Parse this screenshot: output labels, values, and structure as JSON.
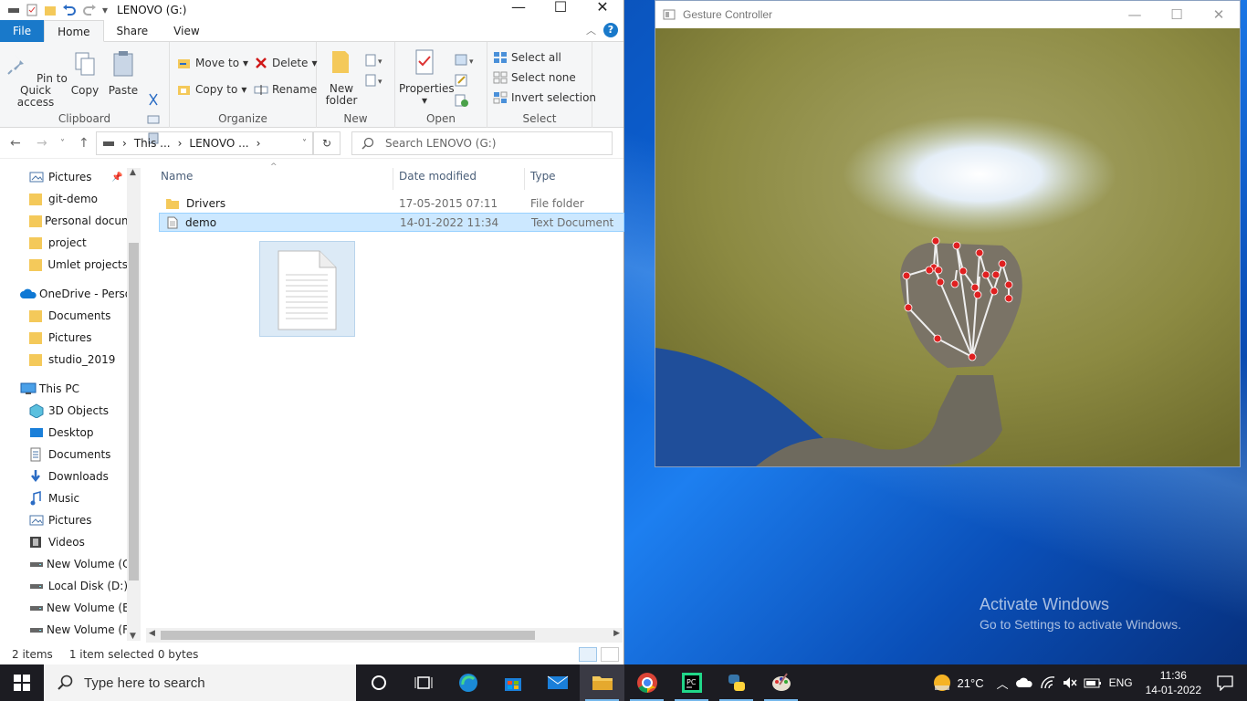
{
  "explorer": {
    "title": "LENOVO (G:)",
    "tabs": {
      "file": "File",
      "home": "Home",
      "share": "Share",
      "view": "View"
    },
    "ribbon": {
      "clipboard": {
        "label": "Clipboard",
        "pin": "Pin to Quick access",
        "copy": "Copy",
        "paste": "Paste"
      },
      "organize": {
        "label": "Organize",
        "move_to": "Move to",
        "copy_to": "Copy to",
        "delete": "Delete",
        "rename": "Rename"
      },
      "new": {
        "label": "New",
        "new_folder": "New folder"
      },
      "open": {
        "label": "Open",
        "properties": "Properties"
      },
      "select": {
        "label": "Select",
        "select_all": "Select all",
        "select_none": "Select none",
        "invert": "Invert selection"
      }
    },
    "address": {
      "part1": "This ...",
      "part2": "LENOVO ..."
    },
    "search": {
      "placeholder": "Search LENOVO (G:)"
    },
    "nav": [
      {
        "label": "Pictures",
        "icon": "pictures-icon"
      },
      {
        "label": "git-demo",
        "icon": "folder-icon"
      },
      {
        "label": "Personal docum",
        "icon": "folder-icon"
      },
      {
        "label": "project",
        "icon": "folder-icon"
      },
      {
        "label": "Umlet projects",
        "icon": "folder-icon"
      },
      {
        "label": "OneDrive - Persor",
        "icon": "onedrive-icon"
      },
      {
        "label": "Documents",
        "icon": "folder-icon"
      },
      {
        "label": "Pictures",
        "icon": "folder-icon"
      },
      {
        "label": "studio_2019",
        "icon": "folder-icon"
      },
      {
        "label": "This PC",
        "icon": "this-pc-icon"
      },
      {
        "label": "3D Objects",
        "icon": "3d-objects-icon"
      },
      {
        "label": "Desktop",
        "icon": "desktop-icon"
      },
      {
        "label": "Documents",
        "icon": "documents-icon"
      },
      {
        "label": "Downloads",
        "icon": "downloads-icon"
      },
      {
        "label": "Music",
        "icon": "music-icon"
      },
      {
        "label": "Pictures",
        "icon": "pictures-icon"
      },
      {
        "label": "Videos",
        "icon": "videos-icon"
      },
      {
        "label": "New Volume (C:",
        "icon": "drive-icon"
      },
      {
        "label": "Local Disk (D:)",
        "icon": "drive-icon"
      },
      {
        "label": "New Volume (E:)",
        "icon": "drive-icon"
      },
      {
        "label": "New Volume (F:)",
        "icon": "drive-icon"
      }
    ],
    "columns": {
      "name": "Name",
      "date": "Date modified",
      "type": "Type"
    },
    "files": [
      {
        "name": "Drivers",
        "date": "17-05-2015 07:11",
        "type": "File folder"
      },
      {
        "name": "demo",
        "date": "14-01-2022 11:34",
        "type": "Text Document"
      }
    ],
    "status": {
      "items": "2 items",
      "selected": "1 item selected",
      "size": "0 bytes"
    }
  },
  "gesture_window": {
    "title": "Gesture Controller"
  },
  "watermark": {
    "line1": "Activate Windows",
    "line2": "Go to Settings to activate Windows."
  },
  "taskbar": {
    "search_placeholder": "Type here to search",
    "weather": "21°C",
    "language": "ENG",
    "time": "11:36",
    "date": "14-01-2022"
  },
  "colors": {
    "accent": "#1979ca",
    "selection": "#cce8ff",
    "taskbar": "#1c1c22"
  }
}
